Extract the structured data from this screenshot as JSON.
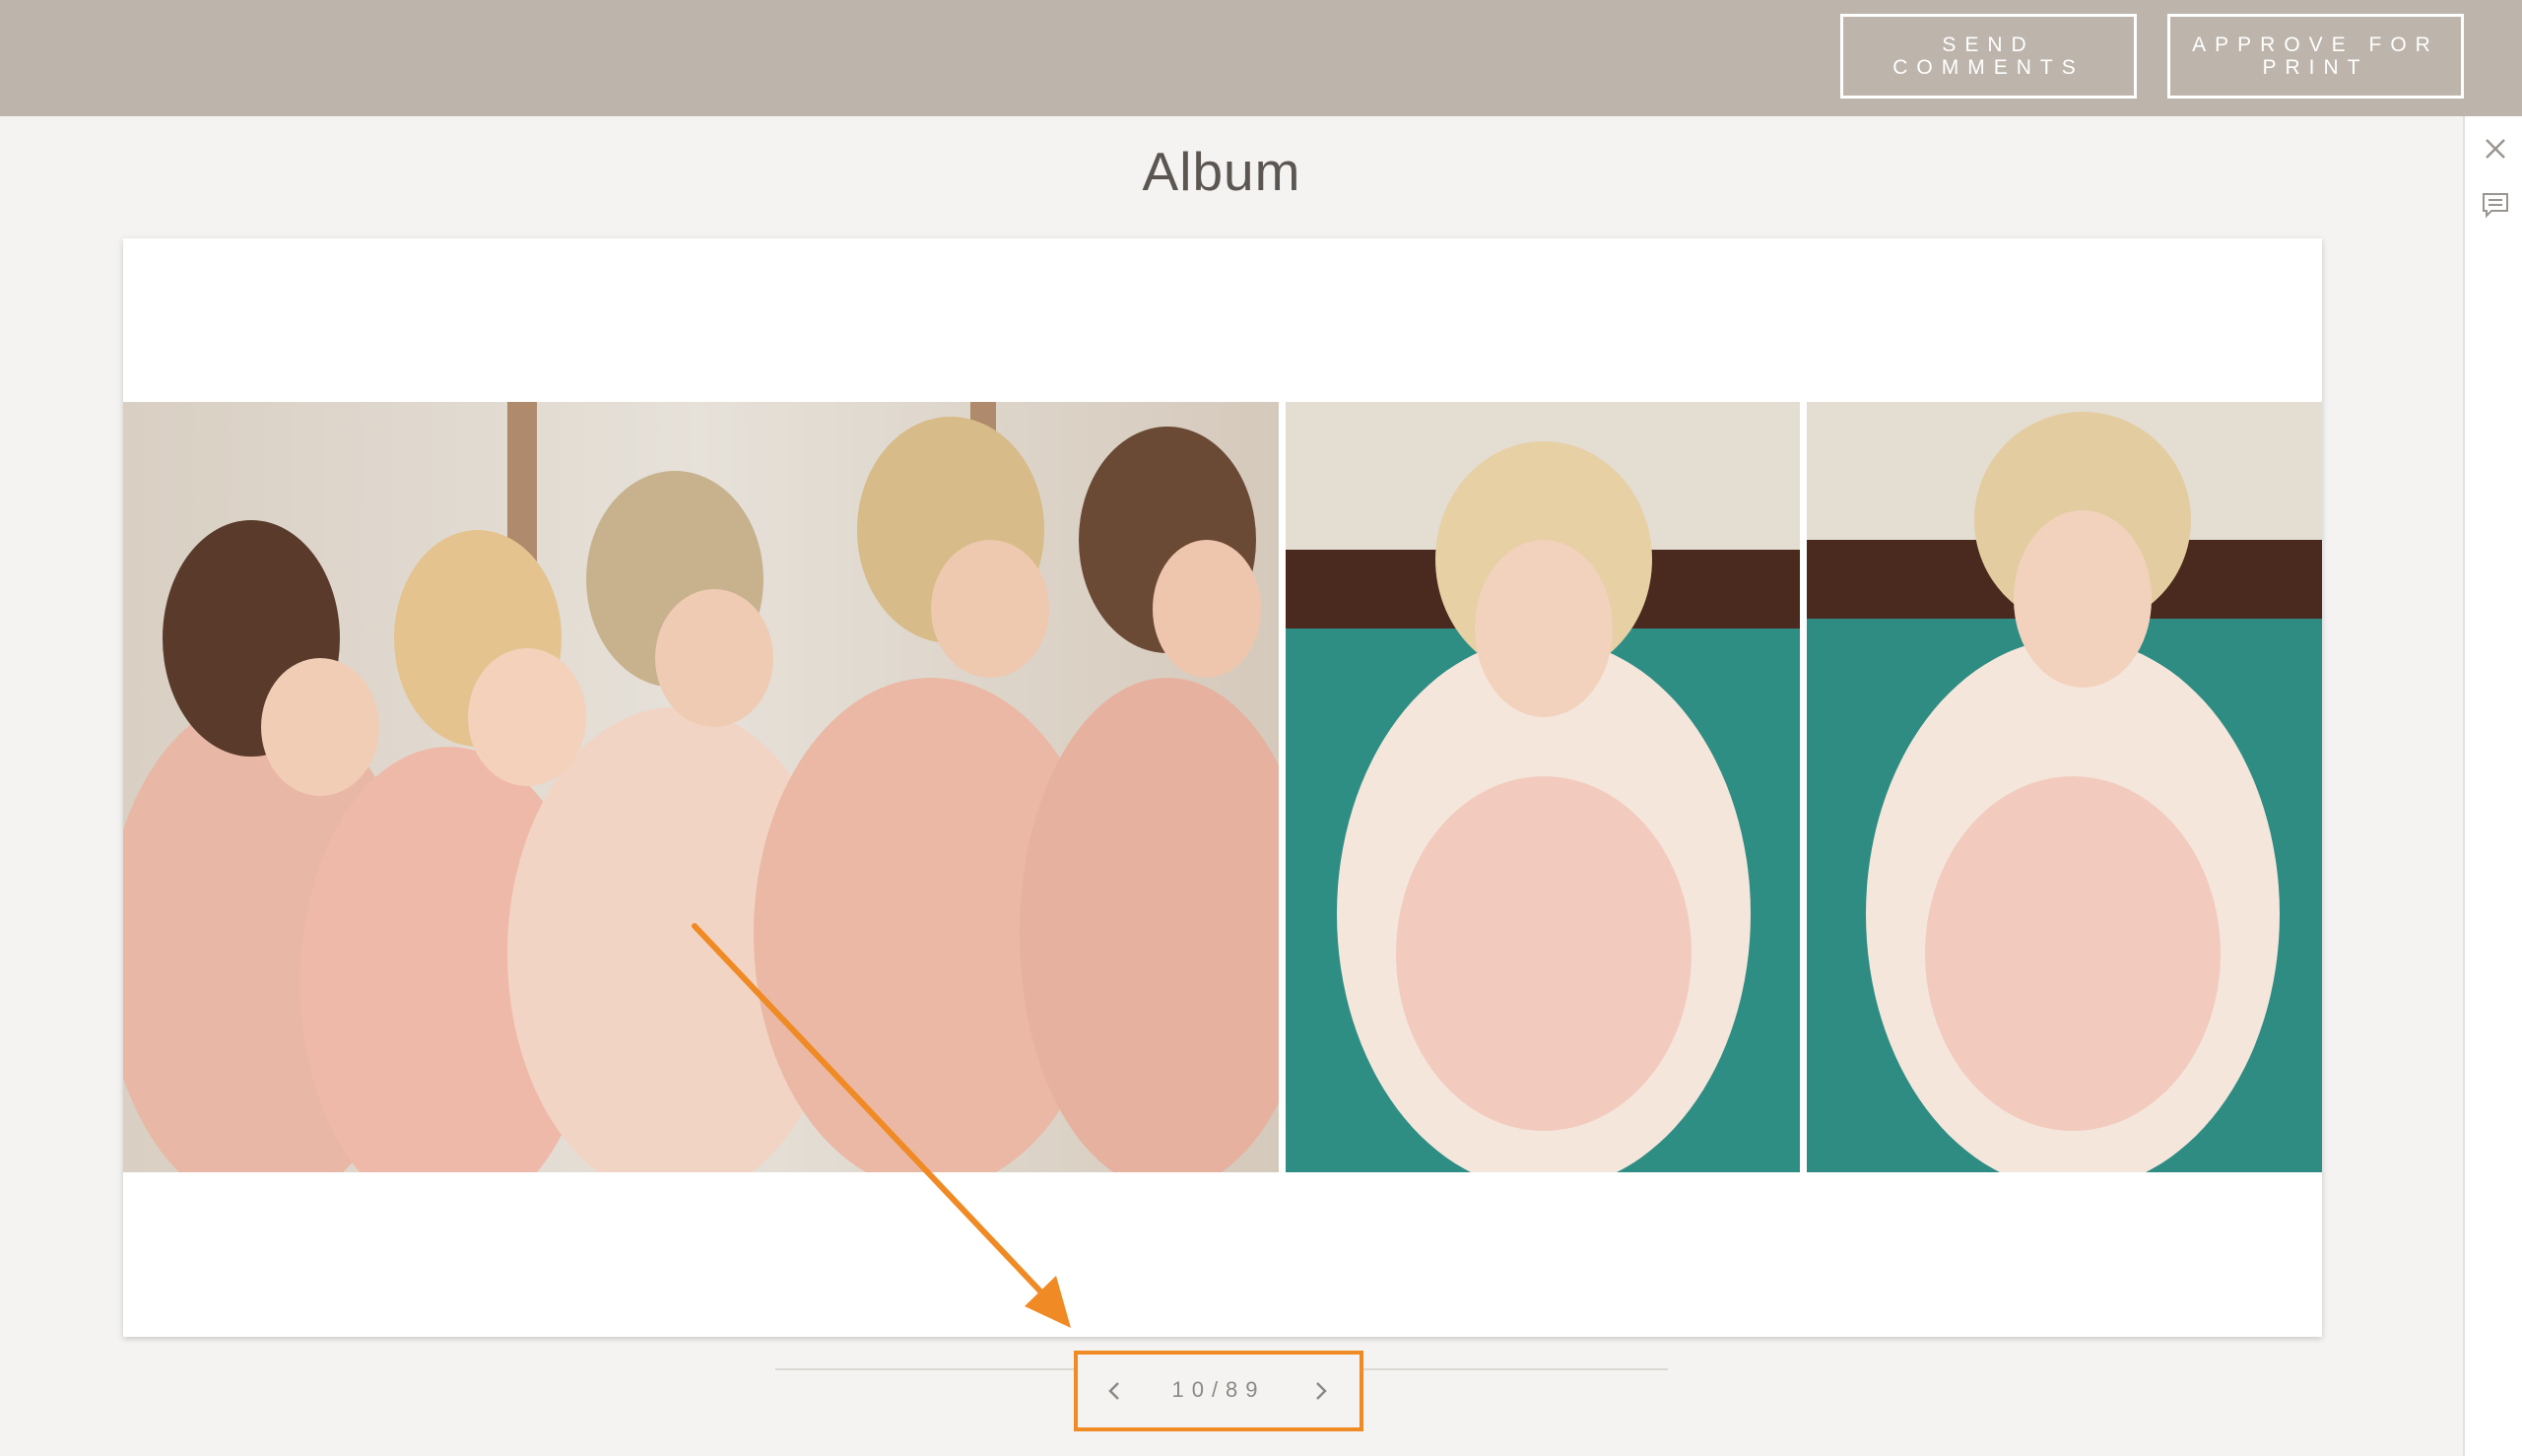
{
  "header": {
    "send_comments_line1": "SEND",
    "send_comments_line2": "COMMENTS",
    "approve_line1": "APPROVE FOR",
    "approve_line2": "PRINT"
  },
  "page": {
    "title": "Album"
  },
  "sidebar": {
    "icons": [
      "close-icon",
      "comment-icon"
    ]
  },
  "pager": {
    "label": "10/89",
    "current": 10,
    "total": 89
  },
  "colors": {
    "header_bg": "#bdb5ab",
    "page_bg": "#f4f3f1",
    "annotation": "#f08a24",
    "text": "#5b5652"
  }
}
